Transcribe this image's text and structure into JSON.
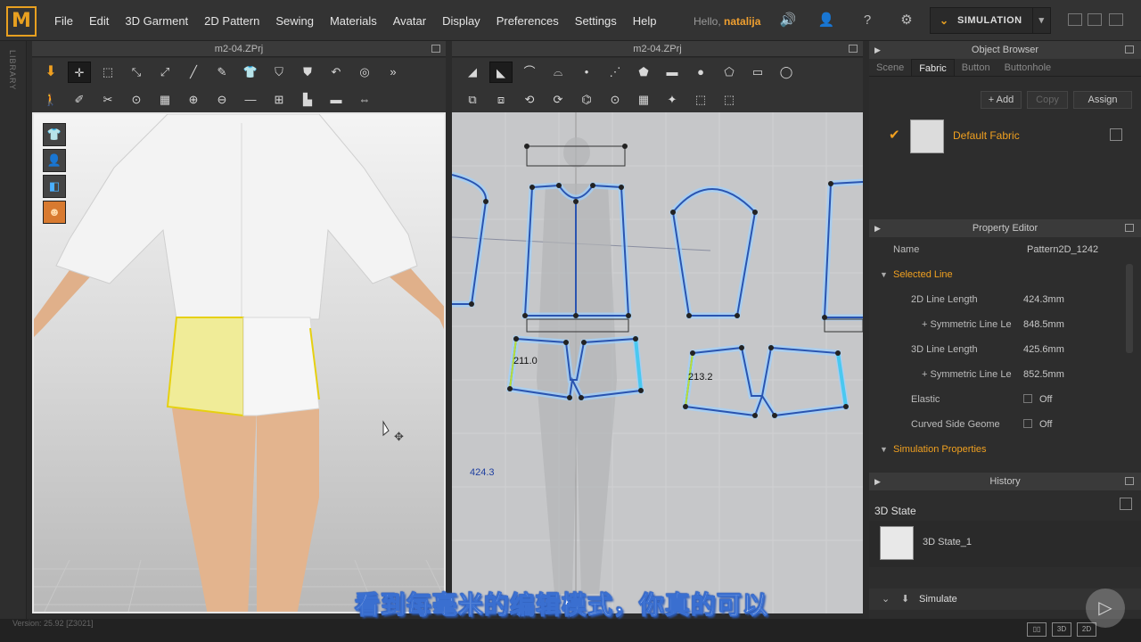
{
  "app": {
    "logo": "M"
  },
  "menu": [
    "File",
    "Edit",
    "3D Garment",
    "2D Pattern",
    "Sewing",
    "Materials",
    "Avatar",
    "Display",
    "Preferences",
    "Settings",
    "Help"
  ],
  "user": {
    "hello": "Hello,",
    "name": "natalija"
  },
  "simulation_label": "SIMULATION",
  "sidebar_label": "LIBRARY",
  "pane3d": {
    "title": "m2-04.ZPrj"
  },
  "pane2d": {
    "title": "m2-04.ZPrj",
    "measure_left": "211.0",
    "measure_right": "213.2",
    "measure_total": "424.3"
  },
  "object_browser": {
    "title": "Object Browser",
    "tabs": [
      "Scene",
      "Fabric",
      "Button",
      "Buttonhole"
    ],
    "active_tab": "Fabric",
    "add": "+ Add",
    "copy": "Copy",
    "assign": "Assign",
    "fabric_name": "Default Fabric"
  },
  "property_editor": {
    "title": "Property Editor",
    "name_label": "Name",
    "name_value": "Pattern2D_1242",
    "selected_line": "Selected Line",
    "rows": [
      {
        "k": "2D Line Length",
        "v": "424.3mm"
      },
      {
        "k": "+ Symmetric Line Le",
        "v": "848.5mm"
      },
      {
        "k": "3D Line Length",
        "v": "425.6mm"
      },
      {
        "k": "+ Symmetric Line Le",
        "v": "852.5mm"
      },
      {
        "k": "Elastic",
        "v": "Off"
      },
      {
        "k": "Curved Side Geome",
        "v": "Off"
      }
    ],
    "simulation_properties": "Simulation Properties"
  },
  "history": {
    "title": "History",
    "state_header": "3D State",
    "item": "3D State_1",
    "simulate": "Simulate"
  },
  "status": {
    "version": "Version: 25.92",
    "build": "[Z3021]"
  },
  "subtitle": "看到每毫米的编辑模式，你真的可以",
  "colors": {
    "accent": "#e8a020",
    "pattern_blue": "#3a78d8",
    "highlight_yellow": "#f0f080"
  }
}
